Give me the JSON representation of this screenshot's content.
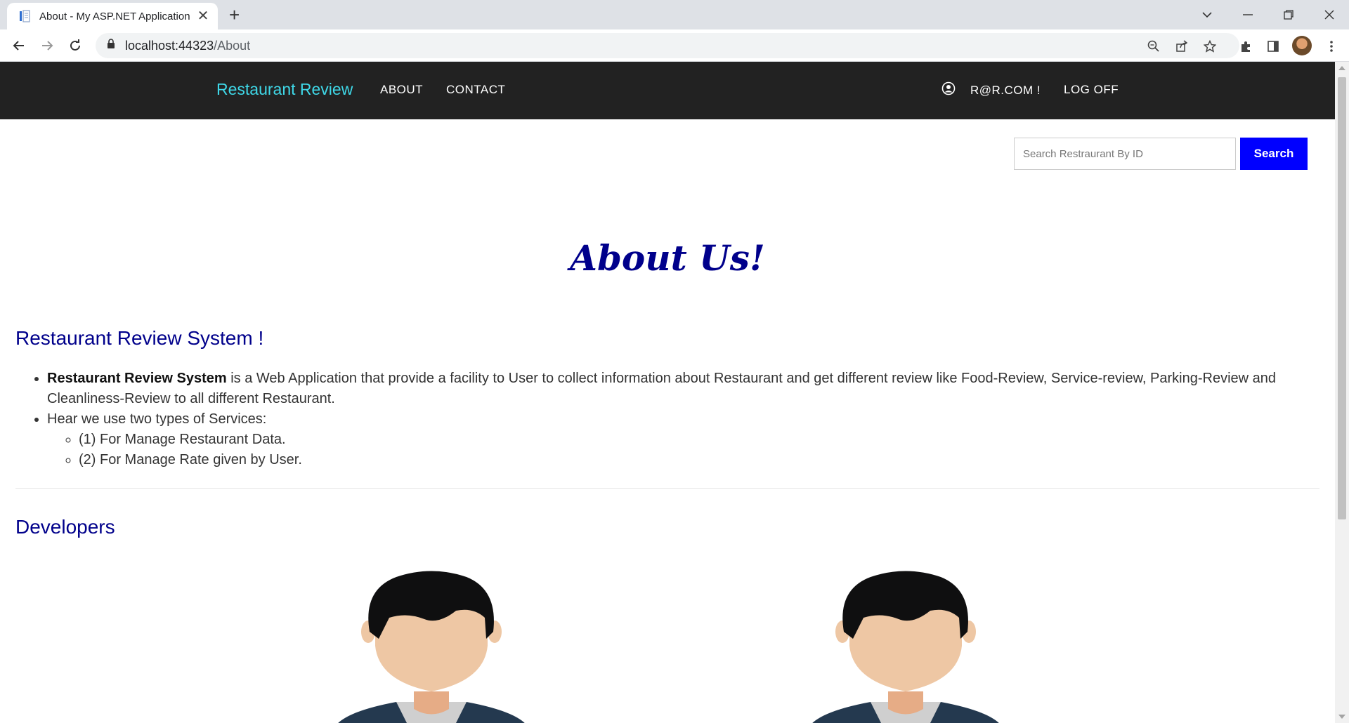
{
  "browser": {
    "tab_title": "About - My ASP.NET Application",
    "new_tab_symbol": "+",
    "close_symbol": "✕",
    "url_host": "localhost:44323",
    "url_path": "/About"
  },
  "navbar": {
    "brand": "Restaurant Review",
    "links": [
      "ABOUT",
      "CONTACT"
    ],
    "user_label": "R@R.COM !",
    "logoff_label": "LOG OFF"
  },
  "search": {
    "placeholder": "Search Restraurant By ID",
    "button_label": "Search"
  },
  "main": {
    "title": "About Us!",
    "section_title": "Restaurant Review System !",
    "item1_bold": "Restaurant Review System",
    "item1_text": " is a Web Application that provide a facility to User to collect information about Restaurant and get different review like Food-Review, Service-review, Parking-Review and Cleanliness-Review to all different Restaurant.",
    "item2_text": "Hear we use two types of Services:",
    "sub_items": [
      "(1) For Manage Restaurant Data.",
      "(2) For Manage Rate given by User."
    ],
    "developers_title": "Developers"
  },
  "colors": {
    "navbar_bg": "#222222",
    "brand": "#3fd8e8",
    "heading": "#00008b",
    "search_button": "#0000ff"
  },
  "icons": [
    "page-favicon",
    "back-icon",
    "forward-icon",
    "reload-icon",
    "lock-icon",
    "zoom-icon",
    "share-icon",
    "star-icon",
    "extensions-icon",
    "side-panel-icon",
    "menu-icon",
    "user-circle-icon",
    "developer-avatar"
  ]
}
